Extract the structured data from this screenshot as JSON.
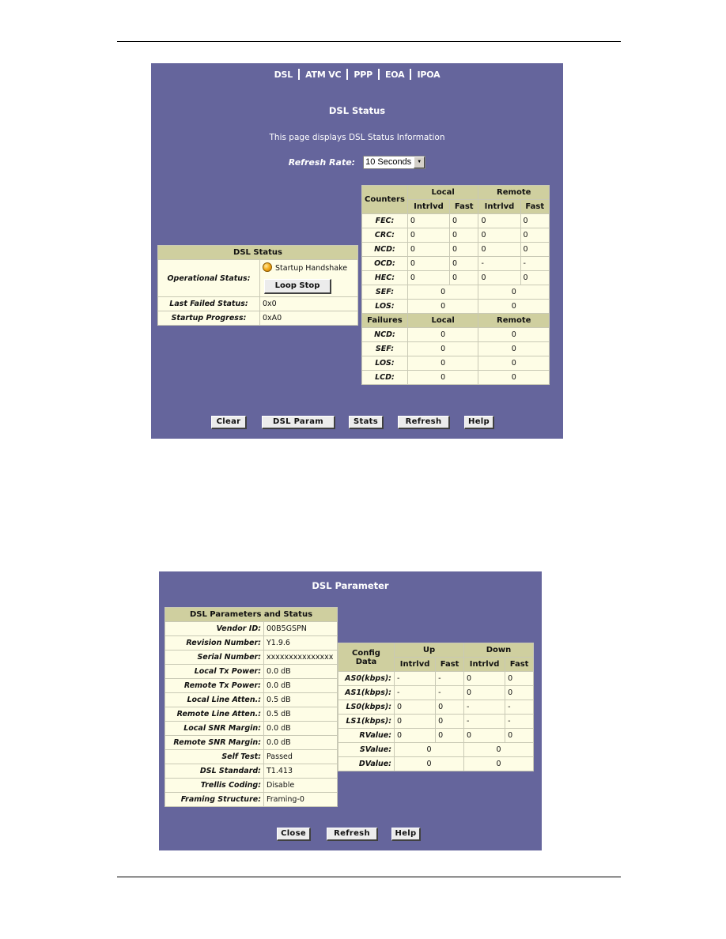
{
  "status_page": {
    "nav": [
      "DSL",
      "ATM VC",
      "PPP",
      "EOA",
      "IPOA"
    ],
    "title": "DSL Status",
    "subtitle": "This page displays DSL Status Information",
    "refresh_rate_label": "Refresh Rate:",
    "refresh_rate_value": "10 Seconds",
    "dsl_status": {
      "header": "DSL Status",
      "operational_status_label": "Operational Status:",
      "operational_status_value": "Startup Handshake",
      "status_color": "#f5b020",
      "loop_stop_label": "Loop Stop",
      "last_failed_label": "Last Failed Status:",
      "last_failed_value": "0x0",
      "startup_progress_label": "Startup Progress:",
      "startup_progress_value": "0xA0"
    },
    "counters": {
      "header": "Counters",
      "local": "Local",
      "remote": "Remote",
      "intrlvd": "Intrlvd",
      "fast": "Fast",
      "rows": [
        {
          "label": "FEC:",
          "values": [
            "0",
            "0",
            "0",
            "0"
          ]
        },
        {
          "label": "CRC:",
          "values": [
            "0",
            "0",
            "0",
            "0"
          ]
        },
        {
          "label": "NCD:",
          "values": [
            "0",
            "0",
            "0",
            "0"
          ]
        },
        {
          "label": "OCD:",
          "values": [
            "0",
            "0",
            "-",
            "-"
          ]
        },
        {
          "label": "HEC:",
          "values": [
            "0",
            "0",
            "0",
            "0"
          ]
        }
      ],
      "merged_rows": [
        {
          "label": "SEF:",
          "local": "0",
          "remote": "0"
        },
        {
          "label": "LOS:",
          "local": "0",
          "remote": "0"
        }
      ]
    },
    "failures": {
      "header": "Failures",
      "local": "Local",
      "remote": "Remote",
      "rows": [
        {
          "label": "NCD:",
          "local": "0",
          "remote": "0"
        },
        {
          "label": "SEF:",
          "local": "0",
          "remote": "0"
        },
        {
          "label": "LOS:",
          "local": "0",
          "remote": "0"
        },
        {
          "label": "LCD:",
          "local": "0",
          "remote": "0"
        }
      ]
    },
    "buttons": {
      "clear": "Clear",
      "dsl_param": "DSL Param",
      "stats": "Stats",
      "refresh": "Refresh",
      "help": "Help"
    }
  },
  "param_page": {
    "title": "DSL Parameter",
    "params": {
      "header": "DSL Parameters and Status",
      "rows": [
        {
          "label": "Vendor ID:",
          "value": "00B5GSPN"
        },
        {
          "label": "Revision Number:",
          "value": "Y1.9.6"
        },
        {
          "label": "Serial Number:",
          "value": "xxxxxxxxxxxxxxx"
        },
        {
          "label": "Local Tx Power:",
          "value": "0.0 dB"
        },
        {
          "label": "Remote Tx Power:",
          "value": "0.0 dB"
        },
        {
          "label": "Local Line Atten.:",
          "value": "0.5 dB"
        },
        {
          "label": "Remote Line Atten.:",
          "value": "0.5 dB"
        },
        {
          "label": "Local SNR Margin:",
          "value": "0.0 dB"
        },
        {
          "label": "Remote SNR Margin:",
          "value": "0.0 dB"
        },
        {
          "label": "Self Test:",
          "value": "Passed"
        },
        {
          "label": "DSL Standard:",
          "value": "T1.413"
        },
        {
          "label": "Trellis Coding:",
          "value": "Disable"
        },
        {
          "label": "Framing Structure:",
          "value": "Framing-0"
        }
      ]
    },
    "config": {
      "header": "Config Data",
      "up": "Up",
      "down": "Down",
      "intrlvd": "Intrlvd",
      "fast": "Fast",
      "rows": [
        {
          "label": "AS0(kbps):",
          "values": [
            "-",
            "-",
            "0",
            "0"
          ]
        },
        {
          "label": "AS1(kbps):",
          "values": [
            "-",
            "-",
            "0",
            "0"
          ]
        },
        {
          "label": "LS0(kbps):",
          "values": [
            "0",
            "0",
            "-",
            "-"
          ]
        },
        {
          "label": "LS1(kbps):",
          "values": [
            "0",
            "0",
            "-",
            "-"
          ]
        },
        {
          "label": "RValue:",
          "values": [
            "0",
            "0",
            "0",
            "0"
          ]
        }
      ],
      "merged_rows": [
        {
          "label": "SValue:",
          "up": "0",
          "down": "0"
        },
        {
          "label": "DValue:",
          "up": "0",
          "down": "0"
        }
      ]
    },
    "buttons": {
      "close": "Close",
      "refresh": "Refresh",
      "help": "Help"
    }
  }
}
